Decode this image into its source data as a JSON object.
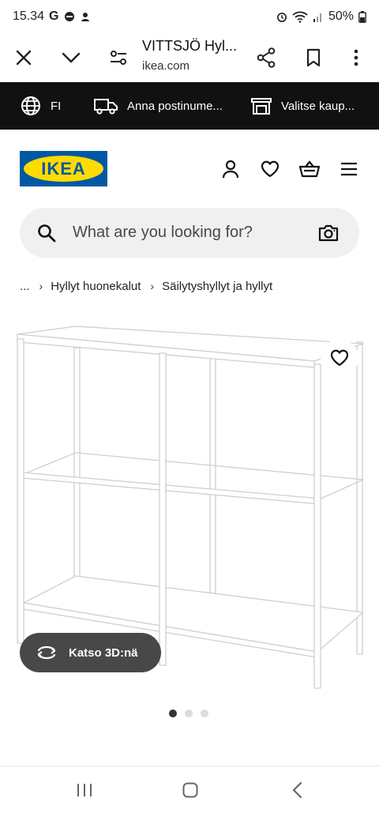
{
  "status_bar": {
    "time": "15.34",
    "g_label": "G",
    "battery": "50%"
  },
  "browser": {
    "title": "VITTSJÖ Hyl...",
    "url": "ikea.com",
    "icons": [
      "close-icon",
      "chevron-down-icon",
      "page-settings-icon",
      "share-icon",
      "bookmark-icon",
      "more-vert-icon"
    ]
  },
  "utility": {
    "language": "FI",
    "delivery": "Anna postinume...",
    "store": "Valitse kaup..."
  },
  "header": {
    "logo_text": "IKEA",
    "brand_blue": "#0058a3",
    "brand_yellow": "#ffdb00"
  },
  "search": {
    "placeholder": "What are you looking for?"
  },
  "breadcrumb": {
    "ellipsis": "...",
    "items": [
      "Hyllyt huonekalut",
      "Säilytyshyllyt ja hyllyt"
    ]
  },
  "product": {
    "view3d_label": "Katso 3D:nä",
    "carousel": {
      "total": 3,
      "active": 1
    }
  }
}
